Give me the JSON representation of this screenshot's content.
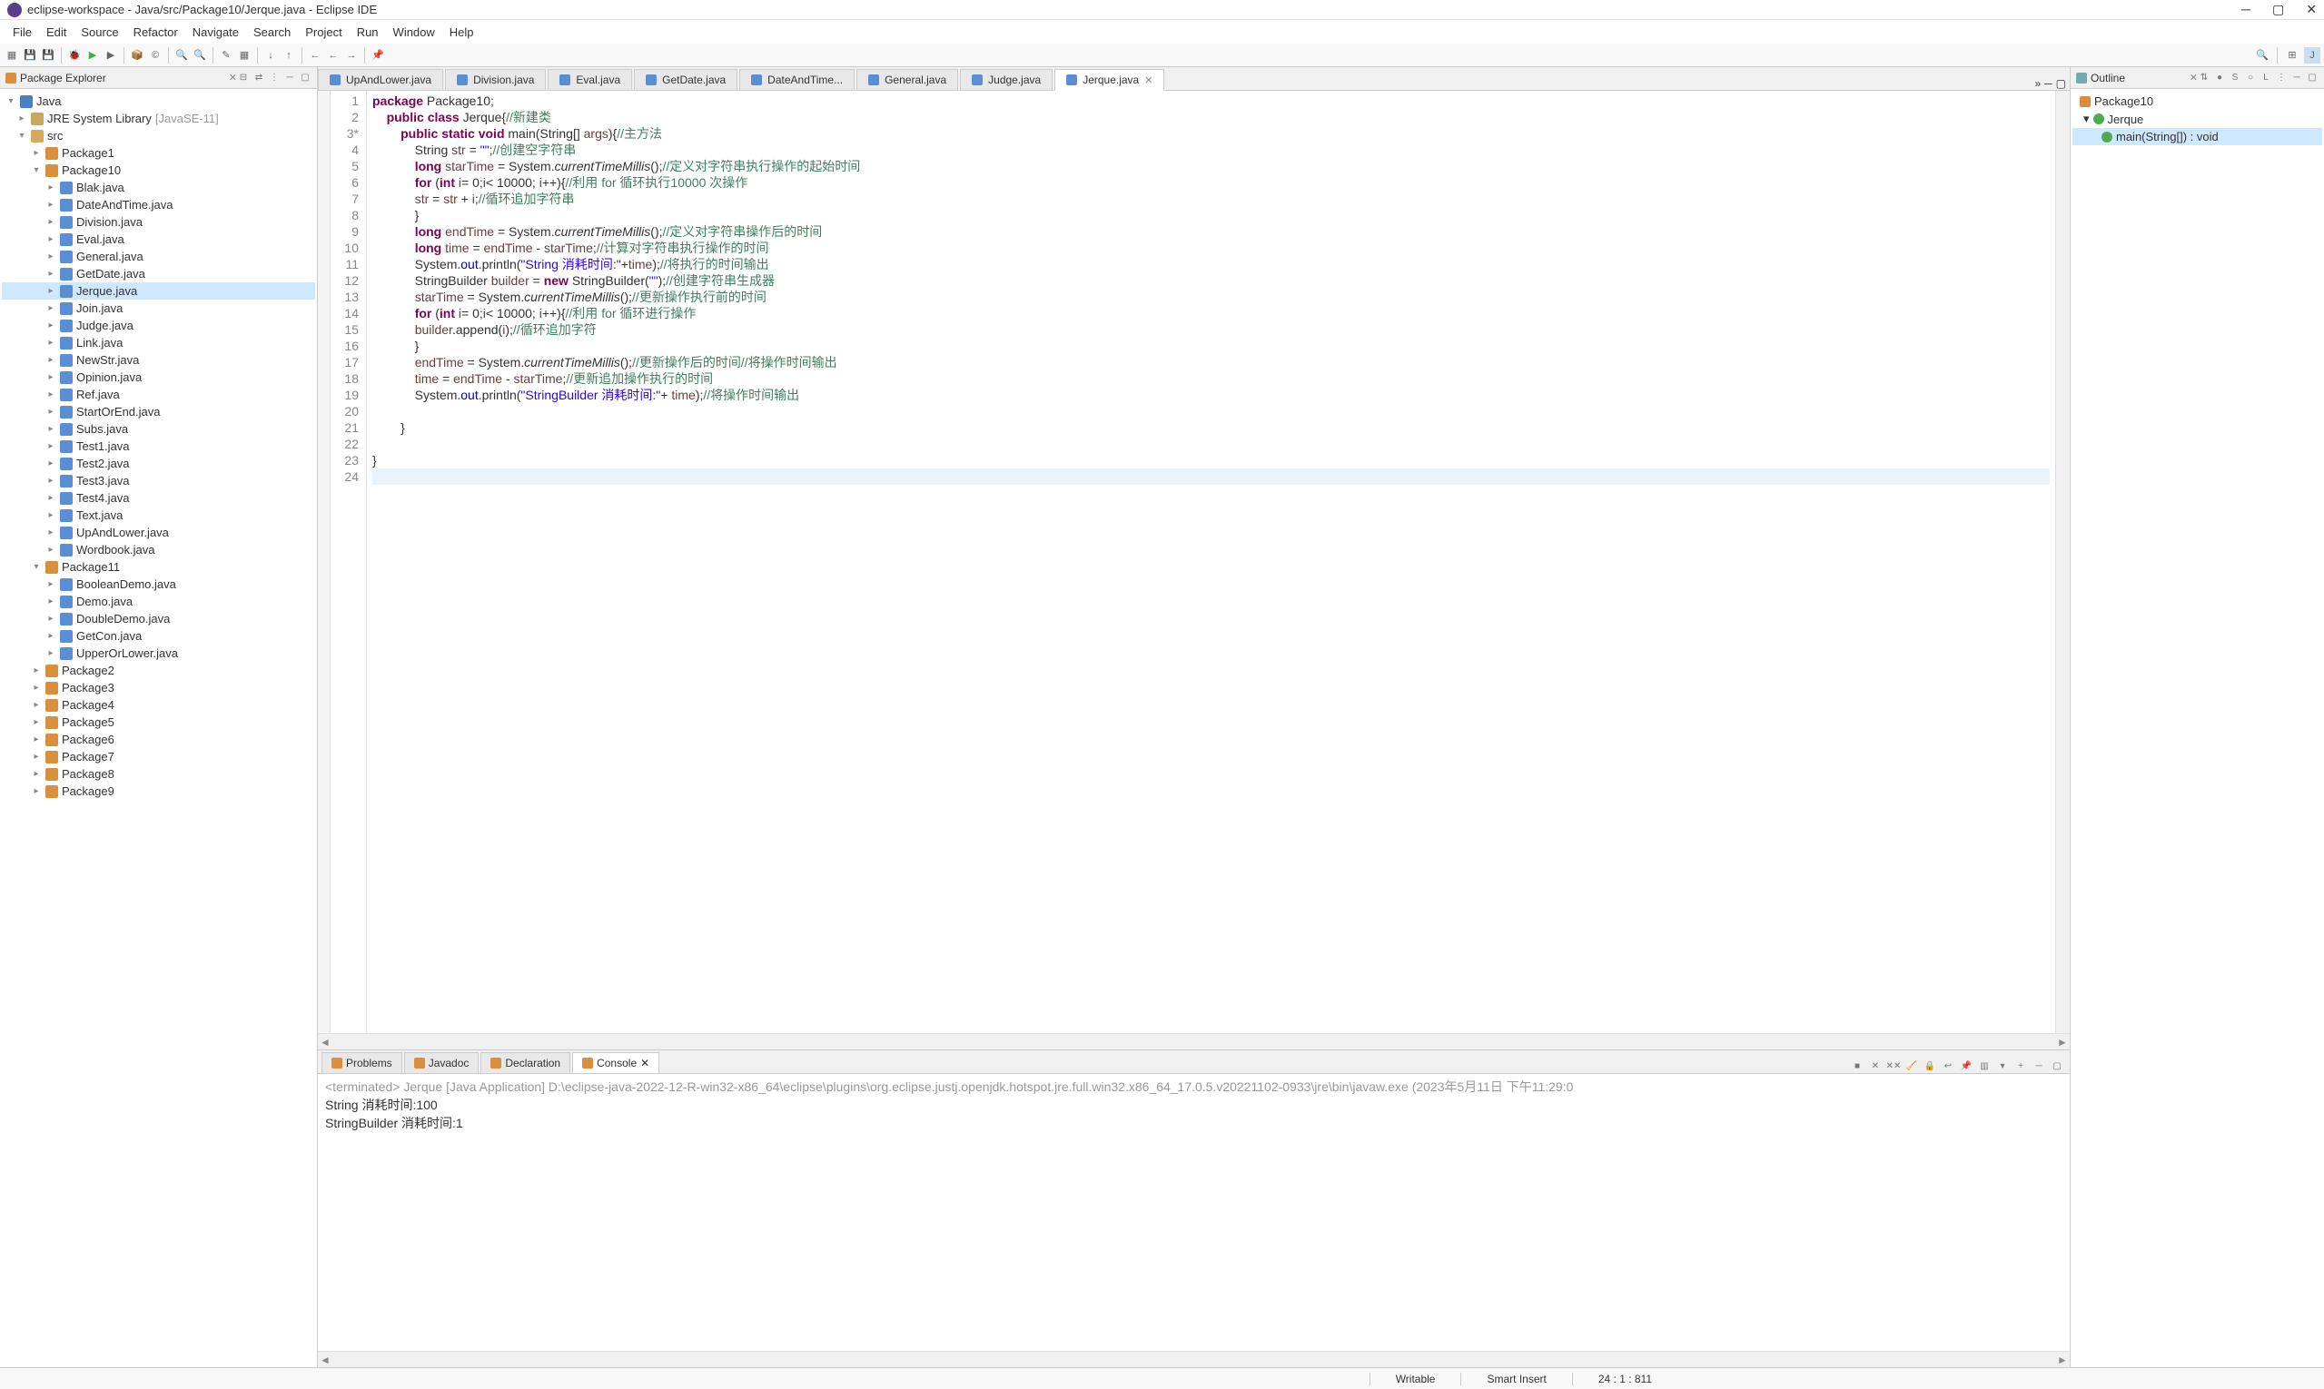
{
  "window": {
    "title": "eclipse-workspace - Java/src/Package10/Jerque.java - Eclipse IDE"
  },
  "menu": [
    "File",
    "Edit",
    "Source",
    "Refactor",
    "Navigate",
    "Search",
    "Project",
    "Run",
    "Window",
    "Help"
  ],
  "views": {
    "pkgExplorer": "Package Explorer",
    "outline": "Outline"
  },
  "tree": {
    "project": "Java",
    "jre": "JRE System Library",
    "jreVer": "[JavaSE-11]",
    "src": "src",
    "packages": {
      "p1": "Package1",
      "p10": "Package10",
      "p10files": [
        "Blak.java",
        "DateAndTime.java",
        "Division.java",
        "Eval.java",
        "General.java",
        "GetDate.java",
        "Jerque.java",
        "Join.java",
        "Judge.java",
        "Link.java",
        "NewStr.java",
        "Opinion.java",
        "Ref.java",
        "StartOrEnd.java",
        "Subs.java",
        "Test1.java",
        "Test2.java",
        "Test3.java",
        "Test4.java",
        "Text.java",
        "UpAndLower.java",
        "Wordbook.java"
      ],
      "p11": "Package11",
      "p11files": [
        "BooleanDemo.java",
        "Demo.java",
        "DoubleDemo.java",
        "GetCon.java",
        "UpperOrLower.java"
      ],
      "rest": [
        "Package2",
        "Package3",
        "Package4",
        "Package5",
        "Package6",
        "Package7",
        "Package8",
        "Package9"
      ]
    }
  },
  "editor": {
    "tabs": [
      "UpAndLower.java",
      "Division.java",
      "Eval.java",
      "GetDate.java",
      "DateAndTime...",
      "General.java",
      "Judge.java",
      "Jerque.java"
    ],
    "activeTab": 7,
    "lines": [
      {
        "n": "1",
        "html": "<span class='kw'>package</span> Package10;"
      },
      {
        "n": "2",
        "html": "    <span class='kw'>public</span> <span class='kw'>class</span> Jerque{<span class='com'>//新建类</span>"
      },
      {
        "n": "3*",
        "html": "        <span class='kw'>public</span> <span class='kw'>static</span> <span class='kw'>void</span> main(String[] <span class='var'>args</span>){<span class='com'>//主方法</span>"
      },
      {
        "n": "4",
        "html": "            String <span class='var'>str</span> = <span class='str'>\"\"</span>;<span class='com'>//创建空字符串</span>"
      },
      {
        "n": "5",
        "html": "            <span class='kw'>long</span> <span class='var'>starTime</span> = System.<span class='method'>currentTimeMillis</span>();<span class='com'>//定义对字符串执行操作的起始时间</span>"
      },
      {
        "n": "6",
        "html": "            <span class='kw'>for</span> (<span class='kw'>int</span> <span class='var'>i</span>= 0;<span class='var'>i</span>&lt; 10000; <span class='var'>i</span>++){<span class='com'>//利用 for 循环执行10000 次操作</span>"
      },
      {
        "n": "7",
        "html": "            <span class='var'>str</span> = <span class='var'>str</span> + <span class='var'>i</span>;<span class='com'>//循环追加字符串</span>"
      },
      {
        "n": "8",
        "html": "            }"
      },
      {
        "n": "9",
        "html": "            <span class='kw'>long</span> <span class='var'>endTime</span> = System.<span class='method'>currentTimeMillis</span>();<span class='com'>//定义对字符串操作后的时间</span>"
      },
      {
        "n": "10",
        "html": "            <span class='kw'>long</span> <span class='var'>time</span> = <span class='var'>endTime</span> - <span class='var'>starTime</span>;<span class='com'>//计算对字符串执行操作的时间</span>"
      },
      {
        "n": "11",
        "html": "            System.<span class='field'>out</span>.println(<span class='str'>\"String 消耗时间:\"</span>+<span class='var'>time</span>);<span class='com'>//将执行的时间输出</span>"
      },
      {
        "n": "12",
        "html": "            StringBuilder <span class='var'>builder</span> = <span class='kw'>new</span> StringBuilder(<span class='str'>\"\"</span>);<span class='com'>//创建字符串生成器</span>"
      },
      {
        "n": "13",
        "html": "            <span class='var'>starTime</span> = System.<span class='method'>currentTimeMillis</span>();<span class='com'>//更新操作执行前的时间</span>"
      },
      {
        "n": "14",
        "html": "            <span class='kw'>for</span> (<span class='kw'>int</span> <span class='var'>i</span>= 0;<span class='var'>i</span>&lt; 10000; <span class='var'>i</span>++){<span class='com'>//利用 for 循环进行操作</span>"
      },
      {
        "n": "15",
        "html": "            <span class='var'>builder</span>.append(<span class='var'>i</span>);<span class='com'>//循环追加字符</span>"
      },
      {
        "n": "16",
        "html": "            }"
      },
      {
        "n": "17",
        "html": "            <span class='var'>endTime</span> = System.<span class='method'>currentTimeMillis</span>();<span class='com'>//更新操作后的时间//将操作时间输出</span>"
      },
      {
        "n": "18",
        "html": "            <span class='var'>time</span> = <span class='var'>endTime</span> - <span class='var'>starTime</span>;<span class='com'>//更新追加操作执行的时间</span>"
      },
      {
        "n": "19",
        "html": "            System.<span class='field'>out</span>.println(<span class='str'>\"StringBuilder 消耗时间:\"</span>+ <span class='var'>time</span>);<span class='com'>//将操作时间输出</span>"
      },
      {
        "n": "20",
        "html": ""
      },
      {
        "n": "21",
        "html": "        }"
      },
      {
        "n": "22",
        "html": ""
      },
      {
        "n": "23",
        "html": "}"
      },
      {
        "n": "24",
        "html": "",
        "current": true
      }
    ]
  },
  "console": {
    "tabs": [
      "Problems",
      "Javadoc",
      "Declaration",
      "Console"
    ],
    "activeTab": 3,
    "terminated": "<terminated> Jerque [Java Application] D:\\eclipse-java-2022-12-R-win32-x86_64\\eclipse\\plugins\\org.eclipse.justj.openjdk.hotspot.jre.full.win32.x86_64_17.0.5.v20221102-0933\\jre\\bin\\javaw.exe  (2023年5月11日 下午11:29:0",
    "out1": "String 消耗时间:100",
    "out2": "StringBuilder 消耗时间:1"
  },
  "outline": {
    "pkg": "Package10",
    "class": "Jerque",
    "method": "main(String[]) : void"
  },
  "status": {
    "writable": "Writable",
    "insert": "Smart Insert",
    "pos": "24 : 1 : 811"
  }
}
